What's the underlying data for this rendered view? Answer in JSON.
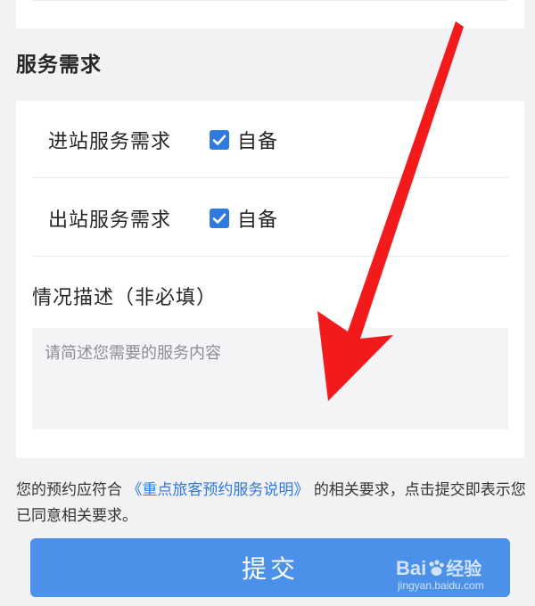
{
  "section": {
    "title": "服务需求"
  },
  "rows": [
    {
      "label": "进站服务需求",
      "option_label": "自备",
      "checked": true
    },
    {
      "label": "出站服务需求",
      "option_label": "自备",
      "checked": true
    }
  ],
  "description": {
    "label": "情况描述（非必填）",
    "placeholder": "请简述您需要的服务内容",
    "value": ""
  },
  "notice": {
    "prefix": "您的预约应符合",
    "link_text": "《重点旅客预约服务说明》",
    "suffix": "的相关要求，点击提交即表示您已同意相关要求。"
  },
  "submit": {
    "label": "提交"
  },
  "watermark": {
    "brand": "Bai",
    "suffix": "经验",
    "domain": "jingyan.baidu.com"
  },
  "colors": {
    "accent": "#2f7ae0",
    "button": "#4b91ea",
    "arrow": "#f21a1a",
    "background": "#f2f2f4"
  }
}
